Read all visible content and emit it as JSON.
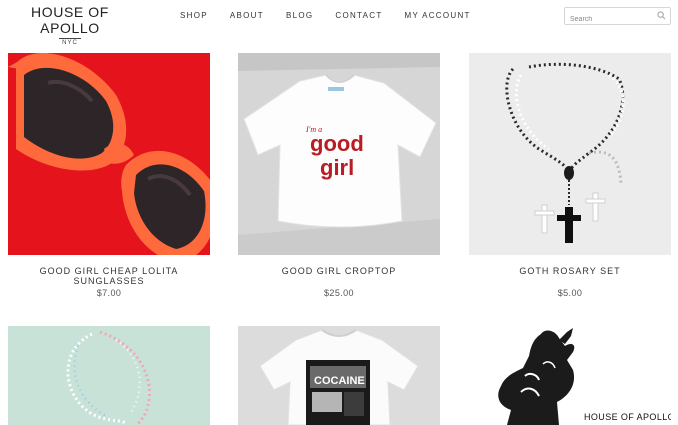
{
  "brand": {
    "name": "HOUSE OF APOLLO",
    "sub": "NYC"
  },
  "nav": [
    "SHOP",
    "ABOUT",
    "BLOG",
    "CONTACT",
    "MY ACCOUNT"
  ],
  "search": {
    "placeholder": "Search"
  },
  "products": [
    {
      "title": "GOOD GIRL CHEAP LOLITA SUNGLASSES",
      "price": "$7.00",
      "image_icon": "heart-sunglasses-image"
    },
    {
      "title": "GOOD GIRL CROPTOP",
      "price": "$25.00",
      "image_icon": "croptop-image",
      "print_small": "I'm a",
      "print_big_1": "good",
      "print_big_2": "girl"
    },
    {
      "title": "GOTH ROSARY SET",
      "price": "$5.00",
      "image_icon": "rosary-image"
    },
    {
      "image_icon": "pastel-rosary-image"
    },
    {
      "image_icon": "cocaine-tshirt-image",
      "print": "COCAINE"
    },
    {
      "image_icon": "statue-logo-image",
      "overlay": "HOUSE OF APOLLO"
    }
  ]
}
